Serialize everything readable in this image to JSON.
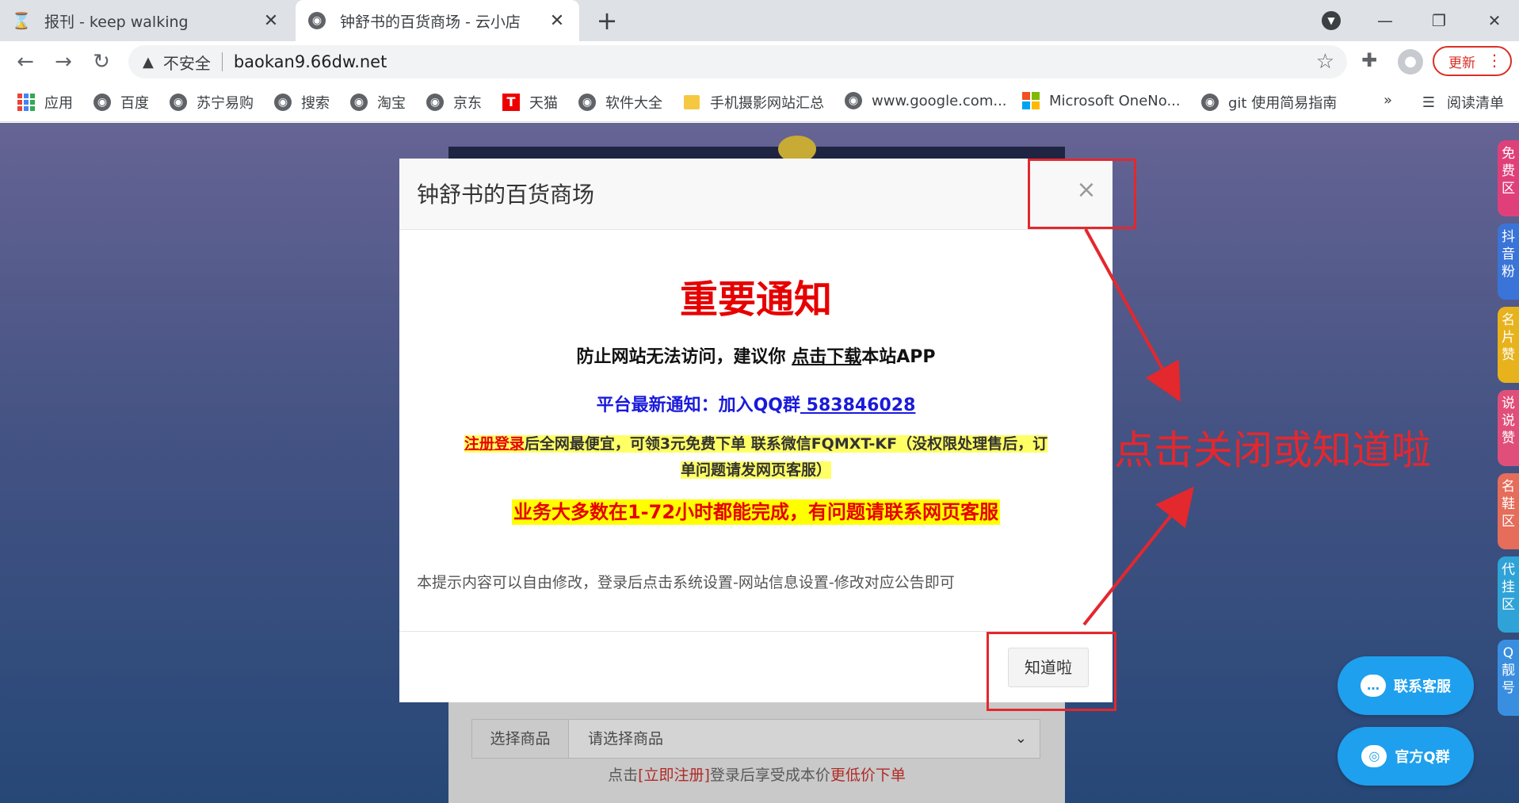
{
  "browser": {
    "tabs": [
      {
        "title": "报刊 - keep walking",
        "icon": "hourglass-icon",
        "active": false
      },
      {
        "title": "钟舒书的百货商场 - 云小店",
        "icon": "globe-icon",
        "active": true
      }
    ],
    "address": {
      "security_label": "不安全",
      "url": "baokan9.66dw.net"
    },
    "update_label": "更新",
    "bookmarks": [
      {
        "label": "应用",
        "icon": "apps-icon"
      },
      {
        "label": "百度",
        "icon": "globe-icon"
      },
      {
        "label": "苏宁易购",
        "icon": "globe-icon"
      },
      {
        "label": "搜索",
        "icon": "globe-icon"
      },
      {
        "label": "淘宝",
        "icon": "globe-icon"
      },
      {
        "label": "京东",
        "icon": "globe-icon"
      },
      {
        "label": "天猫",
        "icon": "tmall-icon"
      },
      {
        "label": "软件大全",
        "icon": "globe-icon"
      },
      {
        "label": "手机摄影网站汇总",
        "icon": "folder-icon"
      },
      {
        "label": "www.google.com...",
        "icon": "globe-icon"
      },
      {
        "label": "Microsoft OneNo...",
        "icon": "microsoft-icon"
      },
      {
        "label": "git 使用简易指南",
        "icon": "globe-icon"
      }
    ],
    "overflow_label": "»",
    "reading_list_label": "阅读清单"
  },
  "side_tabs": [
    {
      "label": "免费区",
      "color": "#e0407a"
    },
    {
      "label": "抖音粉",
      "color": "#3a74d8"
    },
    {
      "label": "名片赞",
      "color": "#e7b21c"
    },
    {
      "label": "说说赞",
      "color": "#e04f7a"
    },
    {
      "label": "名鞋区",
      "color": "#e56d5a"
    },
    {
      "label": "代挂区",
      "color": "#2fa3d8"
    },
    {
      "label": "Q靓号",
      "color": "#3a8ee0"
    }
  ],
  "floating_buttons": {
    "contact": "联系客服",
    "qq_group": "官方Q群"
  },
  "form": {
    "select_label": "选择商品",
    "select_placeholder": "请选择商品",
    "hint_prefix": "点击",
    "hint_link": "[立即注册]",
    "hint_middle": "登录后享受成本价",
    "hint_suffix": "更低价下单"
  },
  "modal": {
    "title": "钟舒书的百货商场",
    "close_symbol": "×",
    "heading": "重要通知",
    "line1_prefix": "防止网站无法访问，建议你 ",
    "line1_link": "点击下载",
    "line1_suffix": "本站APP",
    "line2_prefix": "平台最新通知：加入QQ群",
    "line2_link": " 583846028",
    "line3_link": "注册登录",
    "line3_text": "后全网最便宜，可领3元免费下单 联系微信FQMXT-KF（没权限处理售后，订单问题请发网页客服）",
    "line4": "业务大多数在1-72小时都能完成，有问题请联系网页客服",
    "note": "本提示内容可以自由修改，登录后点击系统设置-网站信息设置-修改对应公告即可",
    "ok_label": "知道啦"
  },
  "annotation": {
    "text": "点击关闭或知道啦",
    "color": "#e3282e"
  }
}
